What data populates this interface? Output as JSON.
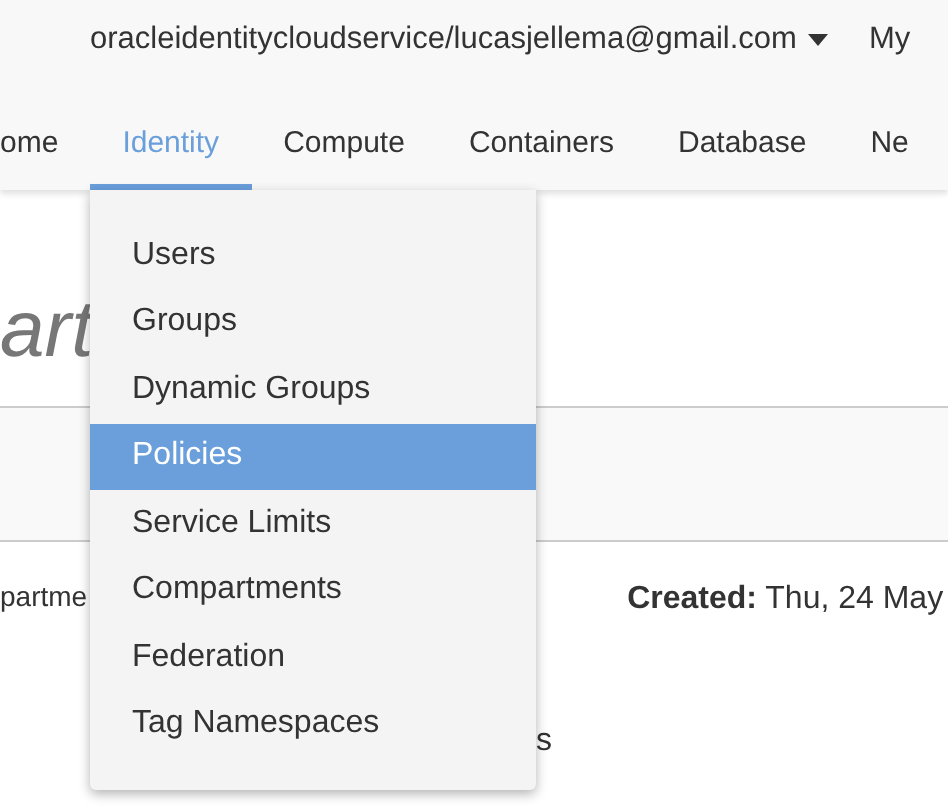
{
  "header": {
    "account": "oracleidentitycloudservice/lucasjellema@gmail.com",
    "menu_cut": "My"
  },
  "tabs": [
    {
      "label": "ome",
      "selected": false
    },
    {
      "label": "Identity",
      "selected": true
    },
    {
      "label": "Compute",
      "selected": false
    },
    {
      "label": "Containers",
      "selected": false
    },
    {
      "label": "Database",
      "selected": false
    },
    {
      "label": "Ne",
      "selected": false
    }
  ],
  "page": {
    "heading": "art",
    "detail_label": "partme",
    "created_label": "Created:",
    "created_value": "Thu, 24 May",
    "trailing": "s"
  },
  "dropdown": [
    {
      "label": "Users",
      "selected": false
    },
    {
      "label": "Groups",
      "selected": false
    },
    {
      "label": "Dynamic Groups",
      "selected": false
    },
    {
      "label": "Policies",
      "selected": true
    },
    {
      "label": "Service Limits",
      "selected": false
    },
    {
      "label": "Compartments",
      "selected": false
    },
    {
      "label": "Federation",
      "selected": false
    },
    {
      "label": "Tag Namespaces",
      "selected": false
    }
  ]
}
